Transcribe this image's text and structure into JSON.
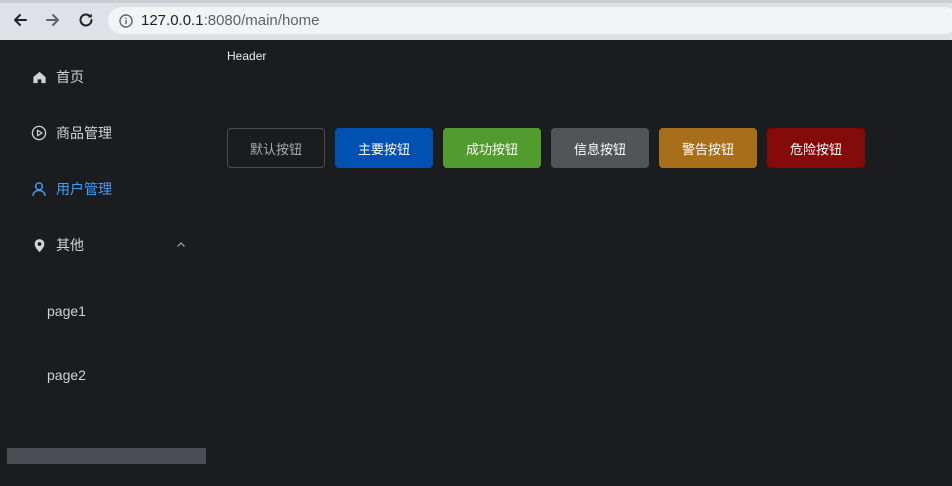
{
  "browser": {
    "url_host": "127.0.0.1",
    "url_rest": ":8080/main/home"
  },
  "sidebar": {
    "items": [
      {
        "label": "首页",
        "icon": "home-icon"
      },
      {
        "label": "商品管理",
        "icon": "video-play-icon"
      },
      {
        "label": "用户管理",
        "icon": "user-icon",
        "active": true
      },
      {
        "label": "其他",
        "icon": "location-icon",
        "expanded": true
      }
    ],
    "subitems": [
      {
        "label": "page1"
      },
      {
        "label": "page2"
      }
    ]
  },
  "header": {
    "title": "Header"
  },
  "buttons": [
    {
      "label": "默认按钮",
      "type": "default"
    },
    {
      "label": "主要按钮",
      "type": "primary"
    },
    {
      "label": "成功按钮",
      "type": "success"
    },
    {
      "label": "信息按钮",
      "type": "info"
    },
    {
      "label": "警告按钮",
      "type": "warning"
    },
    {
      "label": "危险按钮",
      "type": "danger"
    }
  ],
  "colors": {
    "background": "#1b1c1e",
    "active": "#409eff",
    "primary": "#0052b2",
    "success": "#529b2e",
    "info": "#525457",
    "warning": "#a86f1b",
    "danger": "#850a0a"
  }
}
